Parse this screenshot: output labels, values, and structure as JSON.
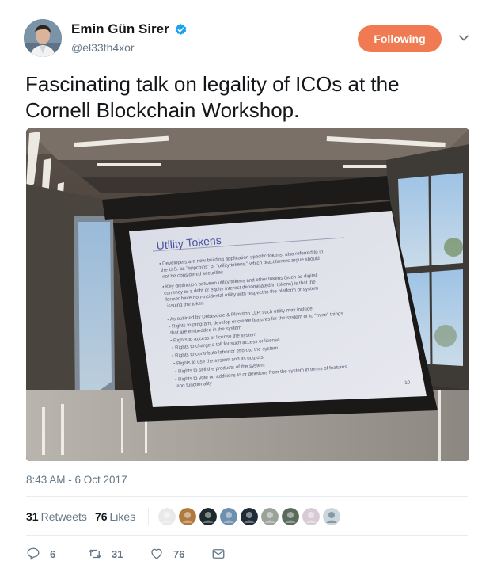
{
  "author": {
    "display_name": "Emin Gün Sirer",
    "handle": "@el33th4xor",
    "verified_icon": "verified-badge-icon",
    "avatar_icon": "avatar-portrait"
  },
  "follow_button": {
    "label": "Following",
    "color": "#f07b52"
  },
  "tweet": {
    "text": "Fascinating talk on legality of ICOs at the Cornell Blockchain Workshop."
  },
  "media": {
    "slide": {
      "title": "Utility Tokens",
      "lines": [
        "• Developers are now building application-specific tokens, also referred to in",
        "  the U.S. as \"appcoins\" or \"utility tokens,\" which practitioners argue should",
        "  not be considered securities",
        "• Key distinction between utility tokens and other tokens (such as digital",
        "  currency or a debt or equity interest denominated in tokens) is that the",
        "  former have non-incidental utility with respect to the platform or system",
        "  issuing the token",
        "• As outlined by Debevoise & Plimpton LLP, such utility may include:",
        "  • Rights to program, develop or create features for the system or to \"mine\" things",
        "    that are embedded in the system",
        "  • Rights to access or license the system",
        "  • Rights to charge a toll for such access or license",
        "  • Rights to contribute labor or effort to the system",
        "  • Rights to use the system and its outputs",
        "  • Rights to sell the products of the system",
        "  • Rights to vote on additions to or deletions from the system in terms of features",
        "    and functionality"
      ],
      "page_number": "10"
    }
  },
  "timestamp": "8:43 AM - 6 Oct 2017",
  "stats": {
    "retweets_count": "31",
    "retweets_label": "Retweets",
    "likes_count": "76",
    "likes_label": "Likes"
  },
  "likers": [
    {
      "icon": "liker-avatar-1",
      "color": "#e9e9e9"
    },
    {
      "icon": "liker-avatar-2",
      "color": "#b07a3e"
    },
    {
      "icon": "liker-avatar-3",
      "color": "#1e2a2e"
    },
    {
      "icon": "liker-avatar-4",
      "color": "#6d8fb0"
    },
    {
      "icon": "liker-avatar-5",
      "color": "#1f2b38"
    },
    {
      "icon": "liker-avatar-6",
      "color": "#9aa39a"
    },
    {
      "icon": "liker-avatar-7",
      "color": "#5a6b5c"
    },
    {
      "icon": "liker-avatar-8",
      "color": "#d9cbd6"
    },
    {
      "icon": "liker-avatar-9",
      "color": "#ccd6dd"
    }
  ],
  "actions": {
    "reply_count": "6",
    "retweet_count": "31",
    "like_count": "76"
  },
  "colors": {
    "text_primary": "#14171a",
    "text_secondary": "#657786",
    "divider": "#e6ecf0",
    "verified": "#1da1f2"
  }
}
